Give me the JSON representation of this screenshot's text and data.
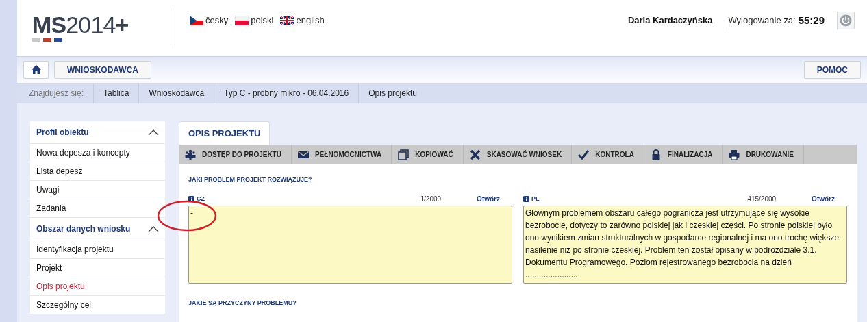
{
  "header": {
    "logo": {
      "main": "MS",
      "rest": "2014",
      "plus": "+"
    },
    "languages": [
      {
        "label": "česky"
      },
      {
        "label": "polski"
      },
      {
        "label": "english"
      }
    ],
    "user": "Daria Kardaczyńska",
    "logout_label": "Wylogowanie za:",
    "logout_time": "55:29"
  },
  "nav": {
    "left": [
      "WNIOSKODAWCA"
    ],
    "right": [
      "POMOC"
    ]
  },
  "breadcrumb": {
    "label": "Znajdujesz się:",
    "items": [
      "Tablica",
      "Wnioskodawca",
      "Typ C - próbny mikro - 06.04.2016",
      "Opis projektu"
    ]
  },
  "sidebar": {
    "sections": [
      {
        "title": "Profil obiektu",
        "expanded": true,
        "items": [
          {
            "label": "Nowa depesza i koncepty",
            "selected": false
          },
          {
            "label": "Lista depesz",
            "selected": false
          },
          {
            "label": "Uwagi",
            "selected": false
          },
          {
            "label": "Zadania",
            "selected": false
          }
        ]
      },
      {
        "title": "Obszar danych wniosku",
        "expanded": true,
        "items": [
          {
            "label": "Identyfikacja projektu",
            "selected": false
          },
          {
            "label": "Projekt",
            "selected": false
          },
          {
            "label": "Opis projektu",
            "selected": true
          },
          {
            "label": "Szczególny cel",
            "selected": false
          }
        ]
      }
    ]
  },
  "tabs": [
    {
      "label": "OPIS PROJEKTU",
      "selected": true
    }
  ],
  "toolbar": [
    {
      "label": "DOSTĘP DO PROJEKTU"
    },
    {
      "label": "PEŁNOMOCNICTWA"
    },
    {
      "label": "KOPIOWAĆ"
    },
    {
      "label": "SKASOWAĆ WNIOSEK"
    },
    {
      "label": "KONTROLA"
    },
    {
      "label": "FINALIZACJA"
    },
    {
      "label": "DRUKOWANIE"
    }
  ],
  "questions": [
    {
      "title": "JAKI PROBLEM PROJEKT ROZWIĄZUJE?",
      "fields": [
        {
          "lang": "CZ",
          "count": "1/2000",
          "link": "Otwórz",
          "value": "-"
        },
        {
          "lang": "PL",
          "count": "415/2000",
          "link": "Otwórz",
          "value": "Głównym problemem obszaru całego pogranicza jest utrzymujące się wysokie bezrobocie, dotyczy to zarówno polskiej jak i czeskiej części. Po stronie polskiej było ono wynikiem zmian strukturalnych w gospodarce regionalnej i ma ono trochę większe nasilenie niż po stronie czeskiej. Problem ten został opisany w podrozdziale 3.1. Dokumentu Programowego. Poziom rejestrowanego bezrobocia na dzień ......................."
        }
      ]
    },
    {
      "title": "JAKIE SĄ PRZYCZYNY PROBLEMU?"
    }
  ],
  "annotations": [
    {
      "kind": "ellipse",
      "color": "#d0202a"
    }
  ]
}
